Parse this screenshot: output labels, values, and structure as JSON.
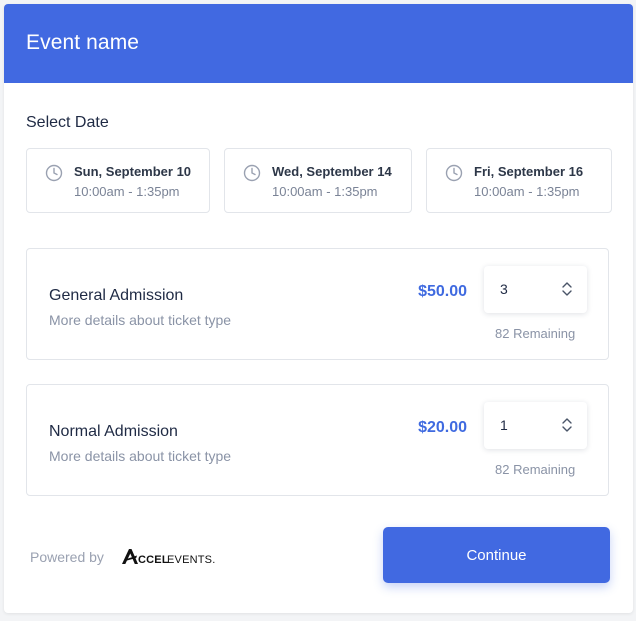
{
  "header": {
    "title": "Event name"
  },
  "select_date": {
    "title": "Select Date",
    "dates": [
      {
        "day": "Sun, September 10",
        "time": "10:00am - 1:35pm"
      },
      {
        "day": "Wed, September 14",
        "time": "10:00am - 1:35pm"
      },
      {
        "day": "Fri, September 16",
        "time": "10:00am - 1:35pm"
      }
    ]
  },
  "tickets": [
    {
      "name": "General Admission",
      "description": "More details about ticket type",
      "price": "$50.00",
      "quantity": "3",
      "remaining": "82 Remaining"
    },
    {
      "name": "Normal Admission",
      "description": "More details about ticket type",
      "price": "$20.00",
      "quantity": "1",
      "remaining": "82 Remaining"
    }
  ],
  "footer": {
    "powered_by": "Powered by",
    "brand": "ACCELEVENTS",
    "continue_label": "Continue"
  },
  "icons": {
    "date_icon": "clock-icon",
    "stepper_icon": "chevron-up-down-icon"
  },
  "colors": {
    "accent": "#4169e1",
    "price": "#3f6ae0",
    "border": "#e2e5ea"
  }
}
